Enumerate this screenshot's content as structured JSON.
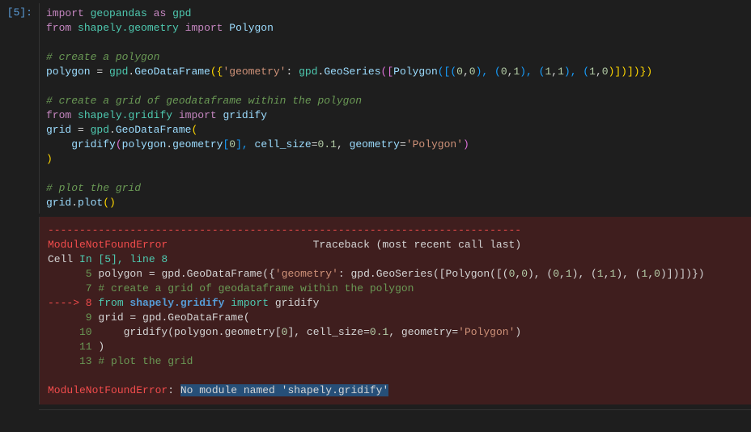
{
  "cell": {
    "prompt": "[5]:",
    "code": {
      "l1_import": "import",
      "l1_gpd_mod": "geopandas",
      "l1_as": "as",
      "l1_alias": "gpd",
      "l2_from": "from",
      "l2_mod": "shapely.geometry",
      "l2_import": "import",
      "l2_name": "Polygon",
      "l4_comment": "# create a polygon",
      "l5_var": "polygon",
      "l5_eq": " = ",
      "l5_gpd": "gpd",
      "l5_dot1": ".",
      "l5_gdf": "GeoDataFrame",
      "l5_open": "({",
      "l5_key": "'geometry'",
      "l5_colon": ": ",
      "l5_gpd2": "gpd",
      "l5_dot2": ".",
      "l5_gs": "GeoSeries",
      "l5_open2": "([",
      "l5_poly": "Polygon",
      "l5_open3": "([(",
      "l5_n0": "0",
      "l5_c": ",",
      "l5_n0b": "0",
      "l5_close_p": "), (",
      "l5_n0c": "0",
      "l5_n1": "1",
      "l5_n1b": "1",
      "l5_n1c": "1",
      "l5_n0d": "0",
      "l5_tail": ")])])})",
      "l7_comment": "# create a grid of geodataframe within the polygon",
      "l8_from": "from",
      "l8_mod": "shapely.gridify",
      "l8_import": "import",
      "l8_name": "gridify",
      "l9_var": "grid",
      "l9_eq": " = ",
      "l9_gpd": "gpd",
      "l9_dot": ".",
      "l9_gdf": "GeoDataFrame",
      "l9_open": "(",
      "l10_indent": "    ",
      "l10_fn": "gridify",
      "l10_open": "(",
      "l10_poly": "polygon",
      "l10_dot": ".",
      "l10_geom": "geometry",
      "l10_idx_open": "[",
      "l10_idx": "0",
      "l10_idx_close": "], ",
      "l10_cs": "cell_size",
      "l10_eq": "=",
      "l10_csv": "0.1",
      "l10_comma": ", ",
      "l10_gk": "geometry",
      "l10_eq2": "=",
      "l10_gv": "'Polygon'",
      "l10_close": ")",
      "l11_close": ")",
      "l13_comment": "# plot the grid",
      "l14_grid": "grid",
      "l14_dot": ".",
      "l14_plot": "plot",
      "l14_call": "()"
    }
  },
  "error": {
    "dashes": "---------------------------------------------------------------------------",
    "err_name": "ModuleNotFoundError",
    "traceback_label": "Traceback (most recent call last)",
    "cell_label": "Cell ",
    "cell_ref": "In [5], line 8",
    "line5_no": "      5",
    "line5_text_a": " polygon ",
    "line5_eq": "=",
    "line5_text_b": " gpd",
    "line5_dot": ".",
    "line5_gdf": "GeoDataFrame({",
    "line5_key": "'geometry'",
    "line5_rest": ": gpd",
    "line5_dot2": ".",
    "line5_gs": "GeoSeries([Polygon([(",
    "line5_n0": "0",
    "line5_c": ",",
    "line5_n0b": "0",
    "line5_p1": "), (",
    "line5_n1": "1",
    "line5_tail": ")])])})",
    "line7_no": "      7",
    "line7_text": " # create a grid of geodataframe within the polygon",
    "line8_arrow": "----> 8",
    "line8_from": " from",
    "line8_mod": " shapely.gridify",
    "line8_import": " import",
    "line8_name": " gridify",
    "line9_no": "      9",
    "line9_text_a": " grid ",
    "line9_eq": "=",
    "line9_text_b": " gpd",
    "line9_dot": ".",
    "line9_gdf": "GeoDataFrame(",
    "line10_no": "     10",
    "line10_text": "     gridify(polygon",
    "line10_dot": ".",
    "line10_geom": "geometry[",
    "line10_idx": "0",
    "line10_rest": "], cell_size",
    "line10_eq": "=",
    "line10_csv": "0.1",
    "line10_rest2": ", geometry",
    "line10_eq2": "=",
    "line10_gv": "'Polygon'",
    "line10_close": ")",
    "line11_no": "     11",
    "line11_text": " )",
    "line13_no": "     13",
    "line13_text": " # plot the grid",
    "final_err": "ModuleNotFoundError",
    "final_colon": ": ",
    "final_msg": "No module named 'shapely.gridify'"
  }
}
